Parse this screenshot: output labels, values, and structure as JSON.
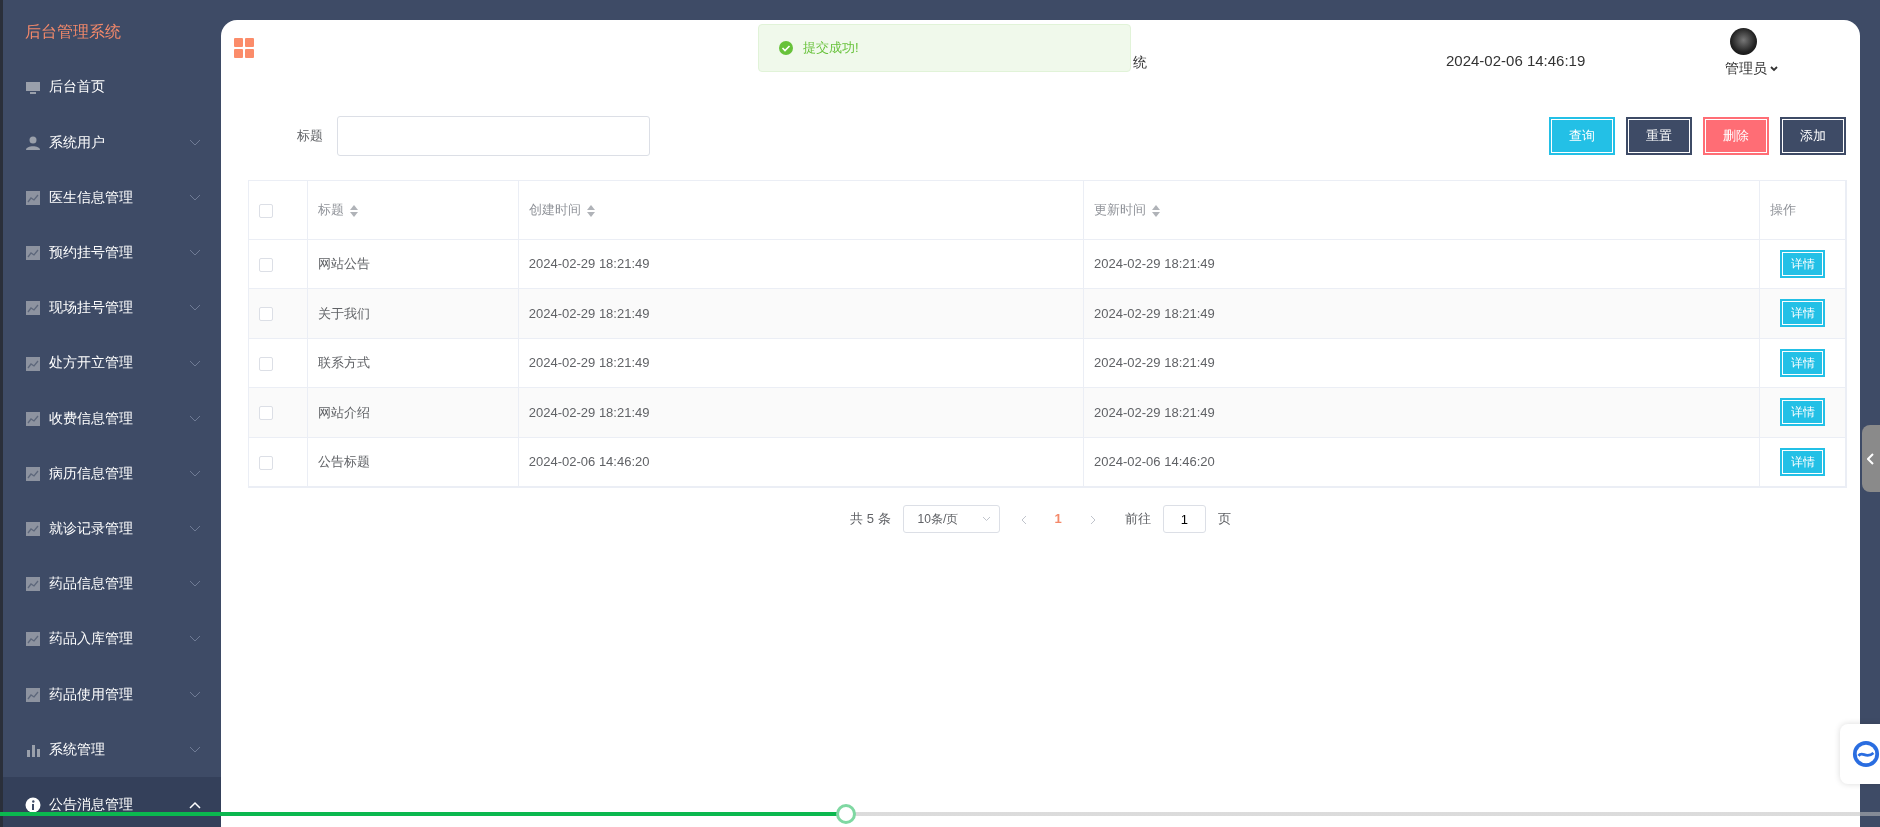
{
  "sidebar": {
    "title": "后台管理系统",
    "items": [
      {
        "label": "后台首页",
        "kind": "home",
        "expandable": false,
        "selected": false
      },
      {
        "label": "系统用户",
        "kind": "users",
        "expandable": true,
        "expanded": false,
        "selected": false
      },
      {
        "label": "医生信息管理",
        "kind": "module",
        "expandable": true,
        "expanded": false,
        "selected": false
      },
      {
        "label": "预约挂号管理",
        "kind": "module",
        "expandable": true,
        "expanded": false,
        "selected": false
      },
      {
        "label": "现场挂号管理",
        "kind": "module",
        "expandable": true,
        "expanded": false,
        "selected": false
      },
      {
        "label": "处方开立管理",
        "kind": "module",
        "expandable": true,
        "expanded": false,
        "selected": false
      },
      {
        "label": "收费信息管理",
        "kind": "module",
        "expandable": true,
        "expanded": false,
        "selected": false
      },
      {
        "label": "病历信息管理",
        "kind": "module",
        "expandable": true,
        "expanded": false,
        "selected": false
      },
      {
        "label": "就诊记录管理",
        "kind": "module",
        "expandable": true,
        "expanded": false,
        "selected": false
      },
      {
        "label": "药品信息管理",
        "kind": "module",
        "expandable": true,
        "expanded": false,
        "selected": false
      },
      {
        "label": "药品入库管理",
        "kind": "module",
        "expandable": true,
        "expanded": false,
        "selected": false
      },
      {
        "label": "药品使用管理",
        "kind": "module",
        "expandable": true,
        "expanded": false,
        "selected": false
      },
      {
        "label": "系统管理",
        "kind": "system",
        "expandable": true,
        "expanded": false,
        "selected": false
      },
      {
        "label": "公告消息管理",
        "kind": "notice",
        "expandable": true,
        "expanded": true,
        "selected": true
      }
    ]
  },
  "header": {
    "title_visible": "统",
    "datetime": "2024-02-06 14:46:19",
    "user": "管理员"
  },
  "toast": {
    "kind": "success",
    "message": "提交成功!"
  },
  "search": {
    "label": "标题"
  },
  "buttons": [
    {
      "label": "查询",
      "kind": "primary"
    },
    {
      "label": "重置",
      "kind": "dark"
    },
    {
      "label": "删除",
      "kind": "danger"
    },
    {
      "label": "添加",
      "kind": "dark"
    }
  ],
  "table": {
    "select_all": {
      "checked": false
    },
    "columns": [
      {
        "label": "标题",
        "sortable": true
      },
      {
        "label": "创建时间",
        "sortable": true
      },
      {
        "label": "更新时间",
        "sortable": true
      },
      {
        "label": "操作",
        "sortable": false
      }
    ],
    "rows": [
      {
        "checked": false,
        "title": "网站公告",
        "created": "2024-02-29 18:21:49",
        "updated": "2024-02-29 18:21:49",
        "action": "详情"
      },
      {
        "checked": false,
        "title": "关于我们",
        "created": "2024-02-29 18:21:49",
        "updated": "2024-02-29 18:21:49",
        "action": "详情"
      },
      {
        "checked": false,
        "title": "联系方式",
        "created": "2024-02-29 18:21:49",
        "updated": "2024-02-29 18:21:49",
        "action": "详情"
      },
      {
        "checked": false,
        "title": "网站介绍",
        "created": "2024-02-29 18:21:49",
        "updated": "2024-02-29 18:21:49",
        "action": "详情"
      },
      {
        "checked": false,
        "title": "公告标题",
        "created": "2024-02-06 14:46:20",
        "updated": "2024-02-06 14:46:20",
        "action": "详情"
      }
    ]
  },
  "pagination": {
    "total": "共 5 条",
    "page_size": "10条/页",
    "pages": [
      {
        "label": "1",
        "selected": true
      }
    ],
    "prev_disabled": true,
    "next_disabled": true,
    "goto_label": "前往",
    "goto_value": "1",
    "goto_suffix": "页"
  },
  "video_progress": {
    "level": 0.45
  }
}
